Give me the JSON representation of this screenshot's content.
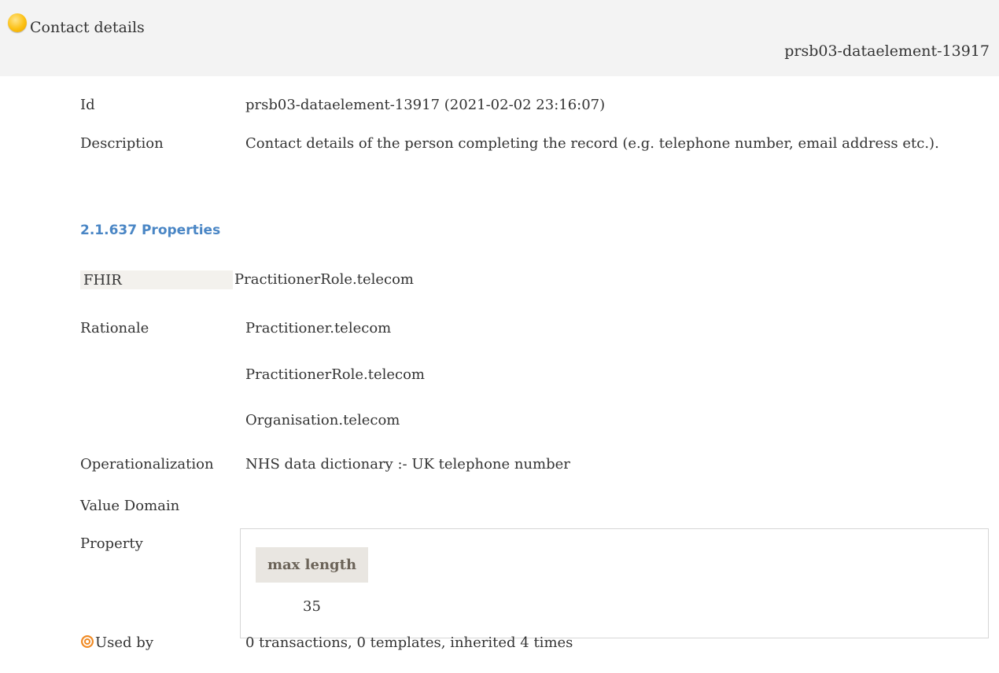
{
  "header": {
    "title": "Contact details",
    "id": "prsb03-dataelement-13917"
  },
  "details": {
    "id_label": "Id",
    "id_value": "prsb03-dataelement-13917 (2021-02-02 23:16:07)",
    "description_label": "Description",
    "description_value": "Contact details of the person completing the record (e.g. telephone number, email address etc.)."
  },
  "properties": {
    "section_title": "2.1.637 Properties",
    "fhir_label": "FHIR",
    "fhir_value": "PractitionerRole.telecom",
    "rationale_label": "Rationale",
    "rationale_values": [
      "Practitioner.telecom",
      "PractitionerRole.telecom",
      "Organisation.telecom"
    ],
    "operationalization_label": "Operationalization",
    "operationalization_value": "NHS data dictionary :- UK telephone number",
    "value_domain_label": "Value Domain",
    "property_label": "Property",
    "property_table": {
      "header": "max length",
      "value": "35"
    },
    "used_by_label": "Used by",
    "used_by_value": "0 transactions, 0 templates, inherited 4 times"
  },
  "colors": {
    "header_bg": "#f3f3f3",
    "section_title": "#4a86c5",
    "status_dot": "#fcc012",
    "used_by_icon": "#f08a24"
  },
  "icons": {
    "status": "status-dot-icon",
    "used_by": "target-icon"
  }
}
